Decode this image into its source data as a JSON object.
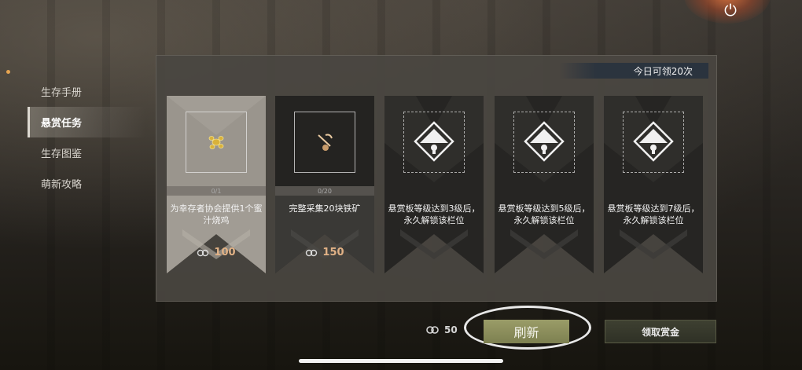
{
  "sidebar": {
    "items": [
      {
        "label": "生存手册",
        "active": false
      },
      {
        "label": "悬赏任务",
        "active": true
      },
      {
        "label": "生存图鉴",
        "active": false
      },
      {
        "label": "萌新攻略",
        "active": false
      }
    ]
  },
  "panel": {
    "daily_limit": "今日可领20次",
    "cards": [
      {
        "progress": "0/1",
        "desc": "为幸存者协会提供1个蜜汁烧鸡",
        "reward": "100",
        "reward_icon": "gear-token-icon",
        "locked": false,
        "theme": "light"
      },
      {
        "progress": "0/20",
        "desc": "完整采集20块铁矿",
        "reward": "150",
        "reward_icon": "gear-token-icon",
        "locked": false,
        "theme": "dark"
      },
      {
        "desc": "悬赏板等级达到3级后，永久解锁该栏位",
        "locked": true
      },
      {
        "desc": "悬赏板等级达到5级后，永久解锁该栏位",
        "locked": true
      },
      {
        "desc": "悬赏板等级达到7级后，永久解锁该栏位",
        "locked": true
      }
    ]
  },
  "footer": {
    "refresh_cost": "50",
    "refresh_label": "刷新",
    "claim_label": "领取赏金"
  },
  "colors": {
    "accent_refresh": "#8a8c5a",
    "reward_text": "#e2b286"
  }
}
